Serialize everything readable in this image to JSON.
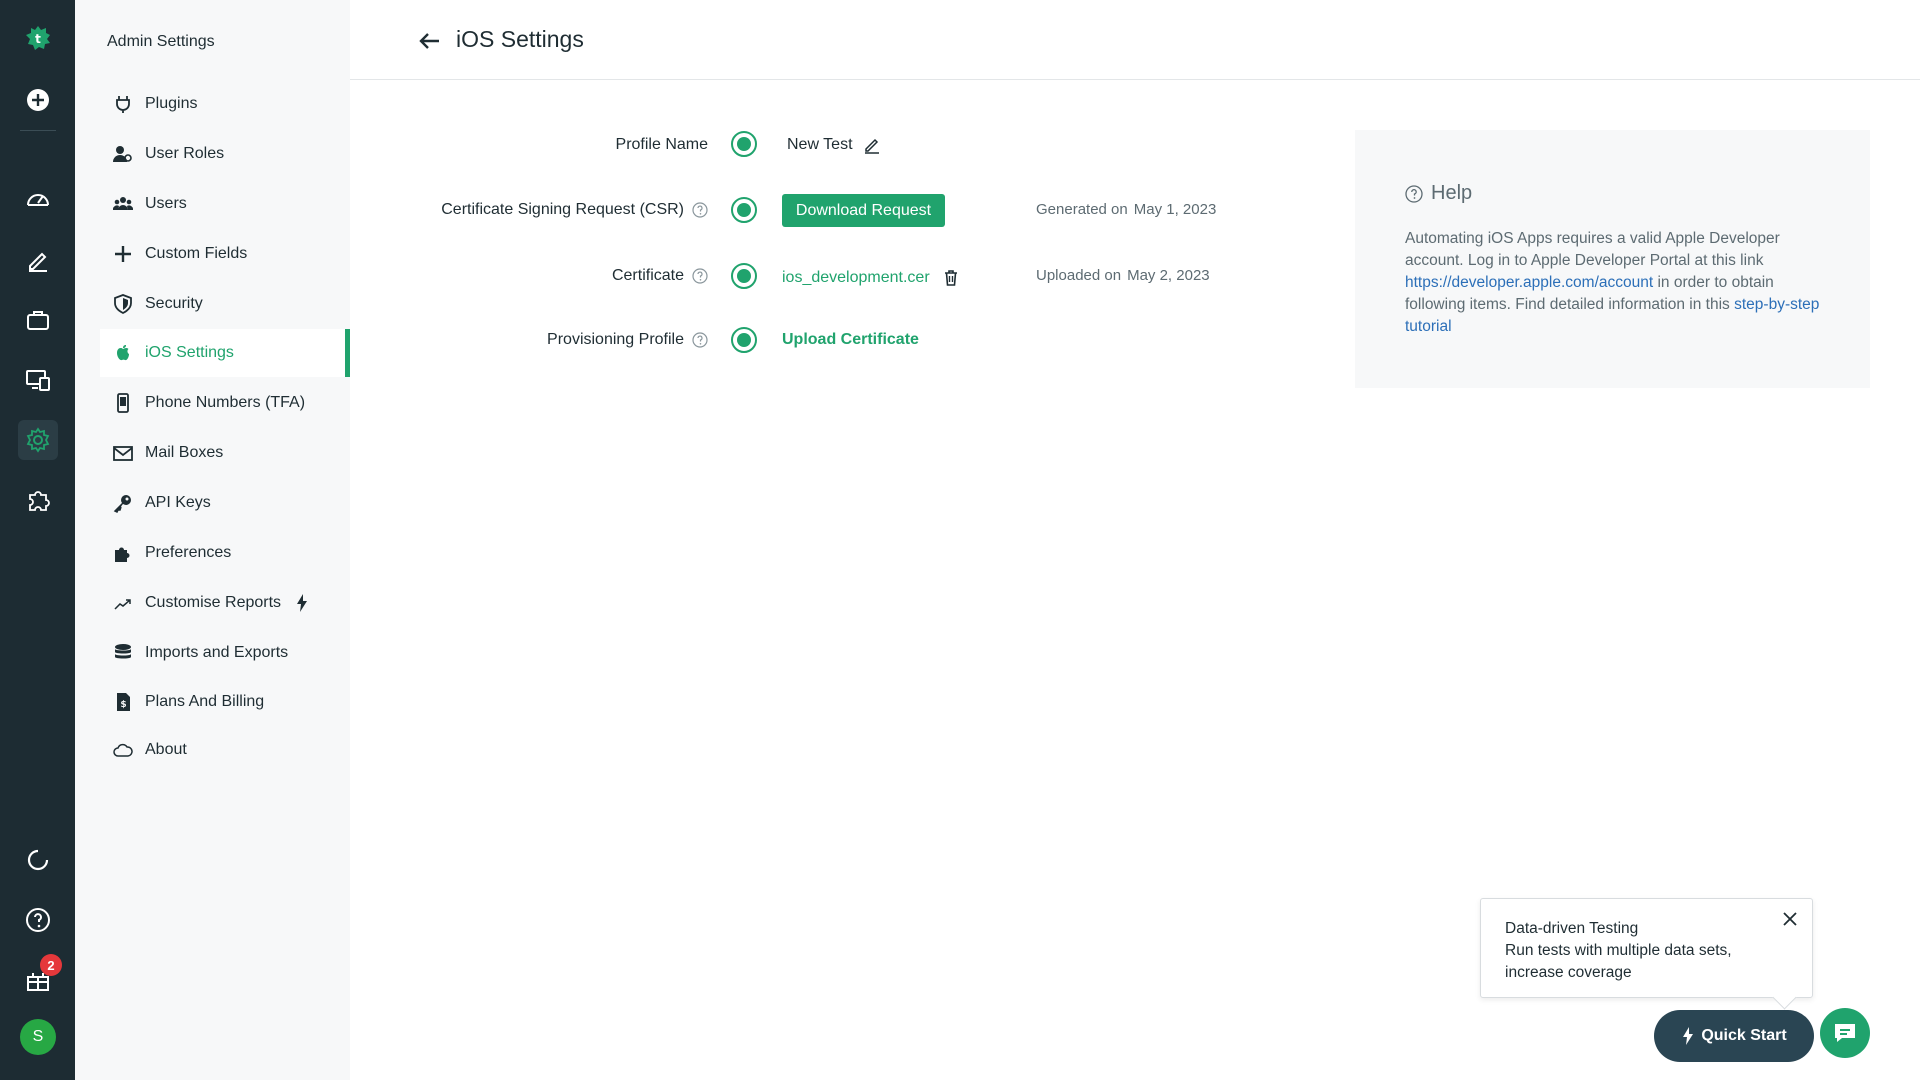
{
  "sidebar": {
    "title": "Admin Settings",
    "items": [
      {
        "label": "Plugins",
        "icon": "plug-icon"
      },
      {
        "label": "User Roles",
        "icon": "user-roles-icon"
      },
      {
        "label": "Users",
        "icon": "users-icon"
      },
      {
        "label": "Custom Fields",
        "icon": "plus-icon"
      },
      {
        "label": "Security",
        "icon": "shield-icon"
      },
      {
        "label": "iOS Settings",
        "icon": "apple-icon",
        "active": true
      },
      {
        "label": "Phone Numbers (TFA)",
        "icon": "phone-icon"
      },
      {
        "label": "Mail Boxes",
        "icon": "mail-icon"
      },
      {
        "label": "API Keys",
        "icon": "key-icon"
      },
      {
        "label": "Preferences",
        "icon": "puzzle-icon"
      },
      {
        "label": "Customise Reports",
        "icon": "trend-icon"
      },
      {
        "label": "Imports and Exports",
        "icon": "database-icon"
      },
      {
        "label": "Plans And Billing",
        "icon": "billing-icon"
      },
      {
        "label": "About",
        "icon": "cloud-icon"
      }
    ]
  },
  "header": {
    "title": "iOS Settings"
  },
  "form": {
    "profile_name": {
      "label": "Profile Name",
      "value": "New Test"
    },
    "csr": {
      "label": "Certificate Signing Request (CSR)",
      "button": "Download Request",
      "meta_prefix": "Generated on",
      "meta_date": "May 1, 2023"
    },
    "certificate": {
      "label": "Certificate",
      "file": "ios_development.cer",
      "meta_prefix": "Uploaded on",
      "meta_date": "May 2, 2023"
    },
    "provisioning": {
      "label": "Provisioning Profile",
      "link": "Upload Certificate"
    }
  },
  "help": {
    "title": "Help",
    "text_1": "Automating iOS Apps requires a valid Apple Developer account. Log in to Apple Developer Portal at this link ",
    "link_1": "https://developer.apple.com/account",
    "text_2": " in order to obtain following items. Find detailed information in this ",
    "link_2": "step-by-step tutorial"
  },
  "tip": {
    "title": "Data-driven Testing",
    "body": "Run tests with multiple data sets, increase coverage"
  },
  "quick_start": {
    "label": "Quick Start"
  },
  "rail": {
    "notifications_count": "2",
    "avatar_initial": "S"
  },
  "colors": {
    "accent": "#20a36d",
    "rail": "#1d2c33",
    "link": "#2c6fb8"
  }
}
